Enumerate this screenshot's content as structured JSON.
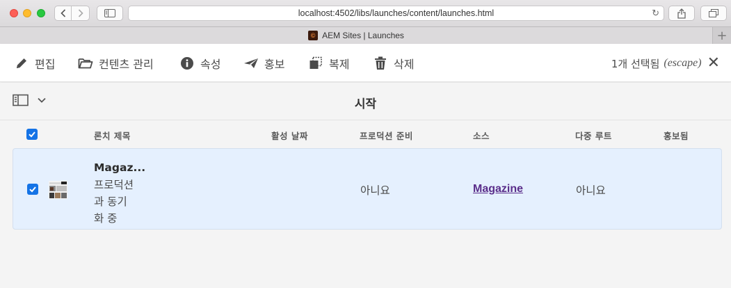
{
  "browser": {
    "url": "localhost:4502/libs/launches/content/launches.html",
    "tab_title": "AEM Sites | Launches",
    "new_tab_label": "+"
  },
  "actionbar": {
    "actions": [
      {
        "label": "편집",
        "icon": "pencil-icon"
      },
      {
        "label": "컨텐츠 관리",
        "icon": "folder-icon"
      },
      {
        "label": "속성",
        "icon": "info-icon"
      },
      {
        "label": "홍보",
        "icon": "send-icon"
      },
      {
        "label": "복제",
        "icon": "copy-icon"
      },
      {
        "label": "삭제",
        "icon": "trash-icon"
      }
    ],
    "selection_count": "1개 선택됨",
    "escape_hint": "(escape)",
    "close_icon": "close-icon"
  },
  "titlebar": {
    "title": "시작",
    "rail_icon": "rail-toggle-icon"
  },
  "table": {
    "columns": [
      "론치 제목",
      "활성 날짜",
      "프로덕션 준비",
      "소스",
      "다중 루트",
      "홍보됨"
    ],
    "rows": [
      {
        "selected": true,
        "title": "Magaz...",
        "status_lines": [
          "프로덕션",
          "과 동기",
          "화 중"
        ],
        "activation_date": "",
        "production_ready": "아니요",
        "source": "Magazine",
        "multiple_roots": "아니요",
        "promoted": ""
      }
    ]
  },
  "colors": {
    "accent": "#1473e6",
    "row_selected_bg": "#e5f0fe",
    "link": "#5a2d8a"
  }
}
